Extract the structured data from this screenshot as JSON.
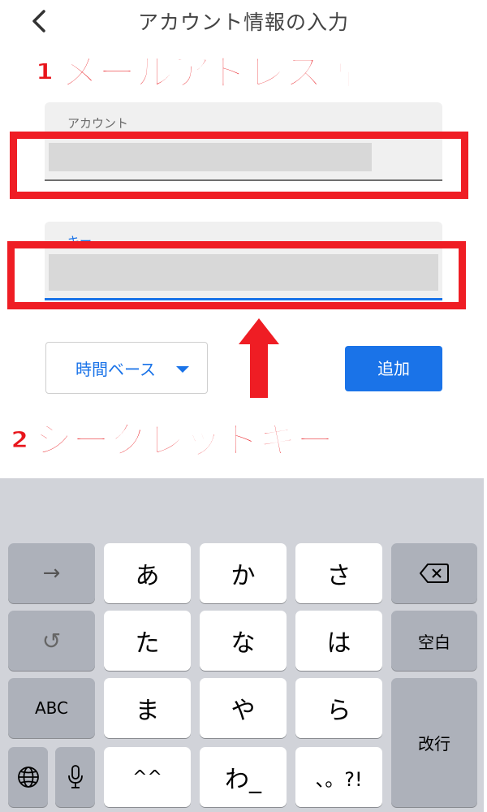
{
  "header": {
    "title": "アカウント情報の入力",
    "back_icon": "chevron-left-icon"
  },
  "annotations": {
    "step1": "①メールアドレス等",
    "step2": "②シークレットキー"
  },
  "form": {
    "account_label": "アカウント",
    "key_label": "キー",
    "type_select_value": "時間ベース",
    "add_button": "追加"
  },
  "colors": {
    "accent": "#1a73e8",
    "annotation_red": "#e8151b"
  },
  "keyboard": {
    "left_column": [
      "→",
      "↺",
      "ABC"
    ],
    "row1": [
      "あ",
      "か",
      "さ"
    ],
    "row2": [
      "た",
      "な",
      "は"
    ],
    "row3": [
      "ま",
      "や",
      "ら"
    ],
    "row4": [
      "^^",
      "わ_",
      "、。?!"
    ],
    "delete_icon": "backspace-icon",
    "space_label": "空白",
    "return_label": "改行",
    "globe_icon": "globe-icon",
    "mic_icon": "microphone-icon"
  }
}
